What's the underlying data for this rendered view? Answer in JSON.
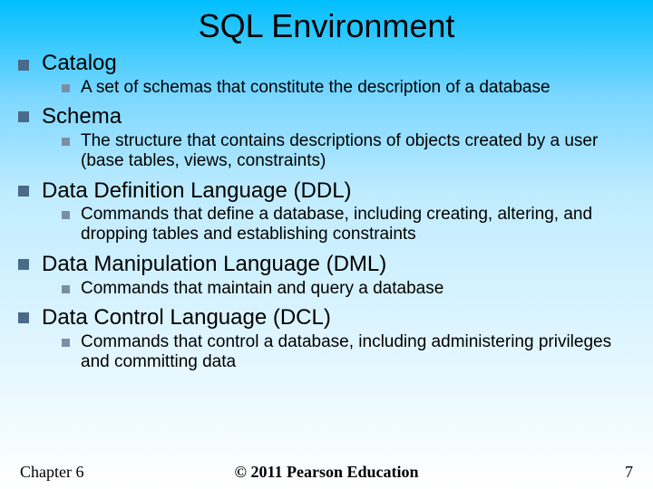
{
  "title": "SQL Environment",
  "items": [
    {
      "label": "Catalog",
      "sub": "A set of schemas that constitute the description of a database"
    },
    {
      "label": "Schema",
      "sub": "The structure that contains descriptions of objects created by a user (base tables, views, constraints)"
    },
    {
      "label": "Data Definition Language (DDL)",
      "sub": "Commands that define a database, including creating, altering, and dropping tables and establishing constraints"
    },
    {
      "label": "Data Manipulation Language (DML)",
      "sub": "Commands that maintain and query a database"
    },
    {
      "label": "Data Control Language (DCL)",
      "sub": "Commands that control a database, including administering privileges and committing data"
    }
  ],
  "footer": {
    "left": "Chapter 6",
    "center": "© 2011 Pearson Education",
    "right": "7"
  }
}
